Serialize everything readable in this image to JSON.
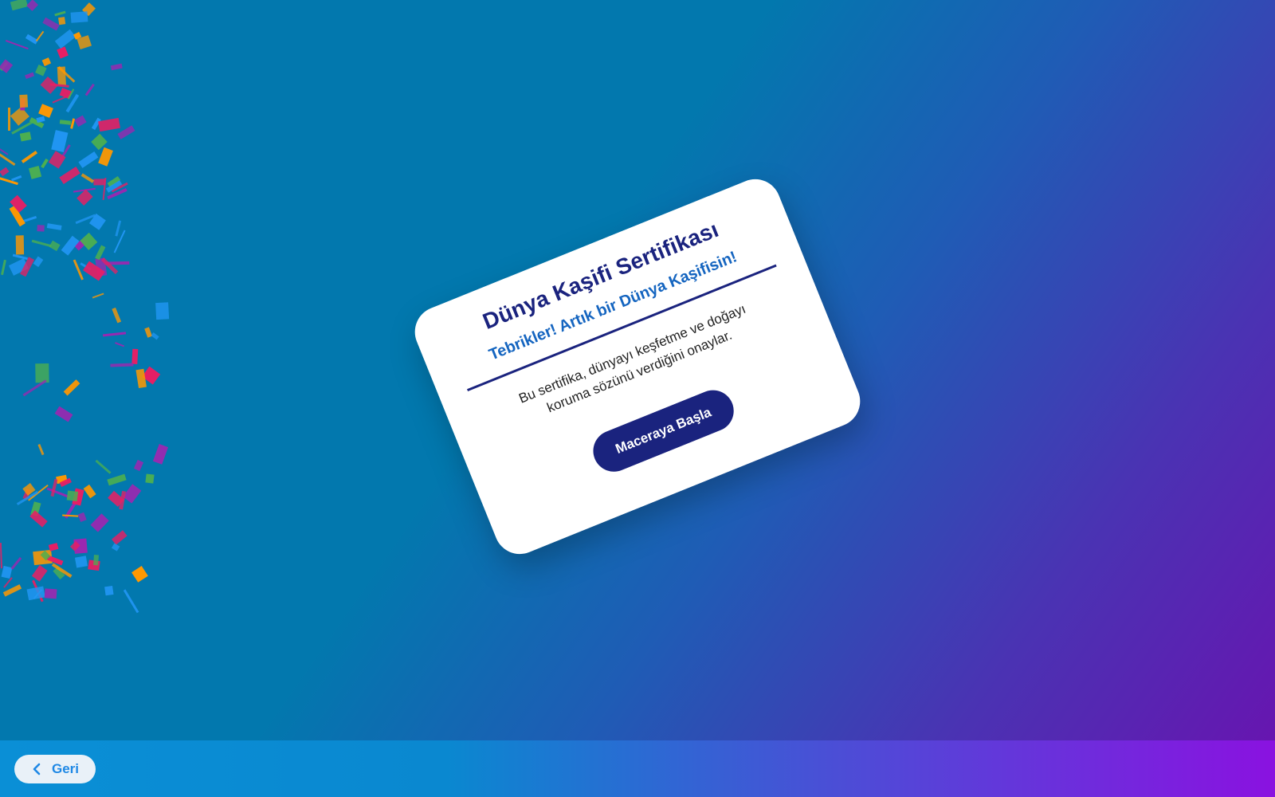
{
  "certificate": {
    "title": "Dünya Kaşifi Sertifikası",
    "subtitle": "Tebrikler! Artık bir Dünya Kaşifisin!",
    "body": "Bu sertifika, dünyayı keşfetme ve doğayı koruma sözünü verdiğini onaylar.",
    "button_label": "Maceraya Başla"
  },
  "footer": {
    "back_label": "Geri",
    "back_icon": "chevron-left-icon"
  },
  "colors": {
    "background_start": "#0278ae",
    "background_end": "#6a12b0",
    "card": "#ffffff",
    "title": "#1a237e",
    "subtitle": "#1565c0",
    "button": "#1a237e",
    "back_text": "#1e88e5",
    "confetti": [
      "#e91e63",
      "#ff9800",
      "#4caf50",
      "#2196f3",
      "#9c27b0",
      "#ffffff"
    ]
  }
}
